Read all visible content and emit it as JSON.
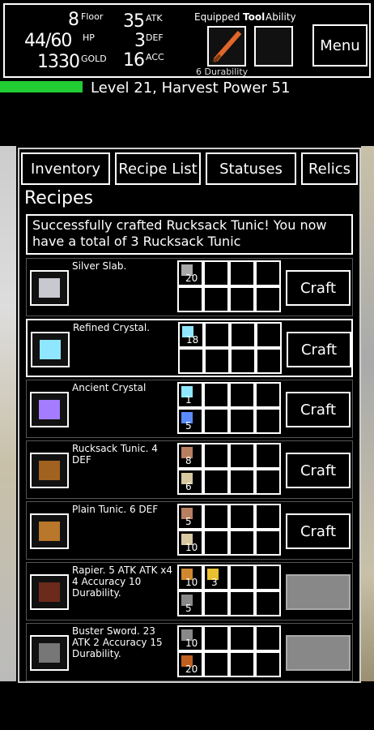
{
  "hud": {
    "floor": "8",
    "floor_label": "Floor",
    "hp": "44/60",
    "hp_label": "HP",
    "gold": "1330",
    "gold_label": "GOLD",
    "atk": "35",
    "atk_label": "ATK",
    "def": "3",
    "def_label": "DEF",
    "acc": "16",
    "acc_label": "ACC",
    "equipped_label": "Equipped",
    "tool_label": "Tool",
    "ability_label": "Ability",
    "durability": "6 Durability",
    "menu": "Menu"
  },
  "level": {
    "text": "Level 21, Harvest Power 51",
    "xp_fraction": 0.22
  },
  "tabs": [
    "Inventory",
    "Recipe List",
    "Statuses",
    "Relics"
  ],
  "recipes_title": "Recipes",
  "message": "Successfully crafted Rucksack Tunic! You now have a total of 3 Rucksack Tunic",
  "recipes": [
    {
      "name": "Silver Slab.",
      "icon": "silver-slab-icon",
      "ingredients": [
        {
          "icon": "ore-icon",
          "count": "20"
        }
      ],
      "craft": "Craft",
      "selected": false,
      "enabled": true
    },
    {
      "name": "Refined Crystal.",
      "icon": "refined-crystal-icon",
      "ingredients": [
        {
          "icon": "crystal-shard-icon",
          "count": "18"
        }
      ],
      "craft": "Craft",
      "selected": true,
      "enabled": true
    },
    {
      "name": "Ancient Crystal",
      "icon": "ancient-crystal-icon",
      "ingredients": [
        {
          "icon": "refined-crystal-icon",
          "count": "1"
        },
        {
          "icon": "sparkle-icon",
          "count": "5"
        }
      ],
      "craft": "Craft",
      "selected": false,
      "enabled": true
    },
    {
      "name": "Rucksack Tunic. 4 DEF",
      "icon": "rucksack-tunic-icon",
      "ingredients": [
        {
          "icon": "hide-icon",
          "count": "8"
        },
        {
          "icon": "fiber-icon",
          "count": "6"
        }
      ],
      "craft": "Craft",
      "selected": false,
      "enabled": true
    },
    {
      "name": "Plain Tunic.  6 DEF",
      "icon": "plain-tunic-icon",
      "ingredients": [
        {
          "icon": "hide-icon",
          "count": "5"
        },
        {
          "icon": "fiber-icon",
          "count": "10"
        }
      ],
      "craft": "Craft",
      "selected": false,
      "enabled": true
    },
    {
      "name": "Rapier.  5 ATK ATK x4  4 Accuracy 10 Durability.",
      "icon": "rapier-icon",
      "ingredients": [
        {
          "icon": "wood-icon",
          "count": "10"
        },
        {
          "icon": "gold-bar-icon",
          "count": "3"
        },
        {
          "icon": "stone-icon",
          "count": "5"
        }
      ],
      "craft": "",
      "selected": false,
      "enabled": false
    },
    {
      "name": "Buster Sword.  23 ATK  2 Accuracy 15 Durability.",
      "icon": "buster-sword-icon",
      "ingredients": [
        {
          "icon": "stone-icon",
          "count": "10"
        },
        {
          "icon": "stick-icon",
          "count": "20"
        }
      ],
      "craft": "",
      "selected": false,
      "enabled": false
    }
  ],
  "colors": {
    "xp": "#22cc33",
    "tool": "#e0662a"
  }
}
